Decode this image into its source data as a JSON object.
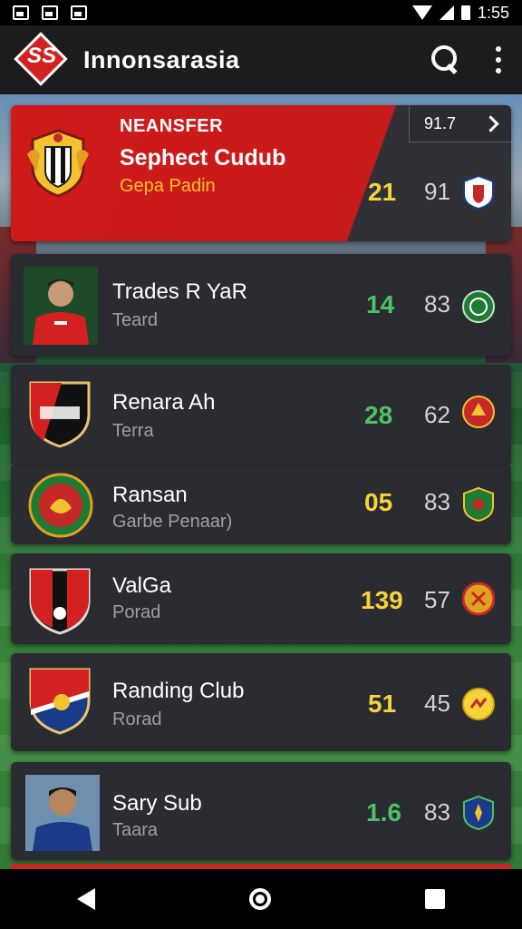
{
  "status_bar": {
    "time": "1:55"
  },
  "app_bar": {
    "title": "Innonsarasia"
  },
  "featured": {
    "tag": "NEANSFER",
    "title": "Sephect Cudub",
    "subtitle": "Gepa Padin",
    "top_value": "91.7",
    "stat_primary": "21",
    "stat_secondary": "91",
    "colors": {
      "primary_stat": "#f5d33b",
      "accent": "#d01a1a"
    }
  },
  "rows": [
    {
      "name": "Trades R YaR",
      "sub": "Teard",
      "stat_primary": "14",
      "stat_secondary": "83",
      "primary_color": "#4cc264",
      "badge_icon": "green-round-crest-icon"
    },
    {
      "name": "Renara Ah",
      "sub": "Terra",
      "stat_primary": "28",
      "stat_secondary": "62",
      "primary_color": "#4cc264",
      "badge_icon": "red-round-crest-icon"
    },
    {
      "name": "Ransan",
      "sub": "Garbe Penaar)",
      "stat_primary": "05",
      "stat_secondary": "83",
      "primary_color": "#f5d33b",
      "badge_icon": "green-shield-crest-icon"
    },
    {
      "name": "ValGa",
      "sub": "Porad",
      "stat_primary": "139",
      "stat_secondary": "57",
      "primary_color": "#f5d33b",
      "badge_icon": "orange-round-crest-icon"
    },
    {
      "name": "Randing Club",
      "sub": "Rorad",
      "stat_primary": "51",
      "stat_secondary": "45",
      "primary_color": "#f5d33b",
      "badge_icon": "yellow-round-crest-icon"
    },
    {
      "name": "Sary Sub",
      "sub": "Taara",
      "stat_primary": "1.6",
      "stat_secondary": "83",
      "primary_color": "#4cc264",
      "badge_icon": "blue-shield-crest-icon"
    }
  ]
}
